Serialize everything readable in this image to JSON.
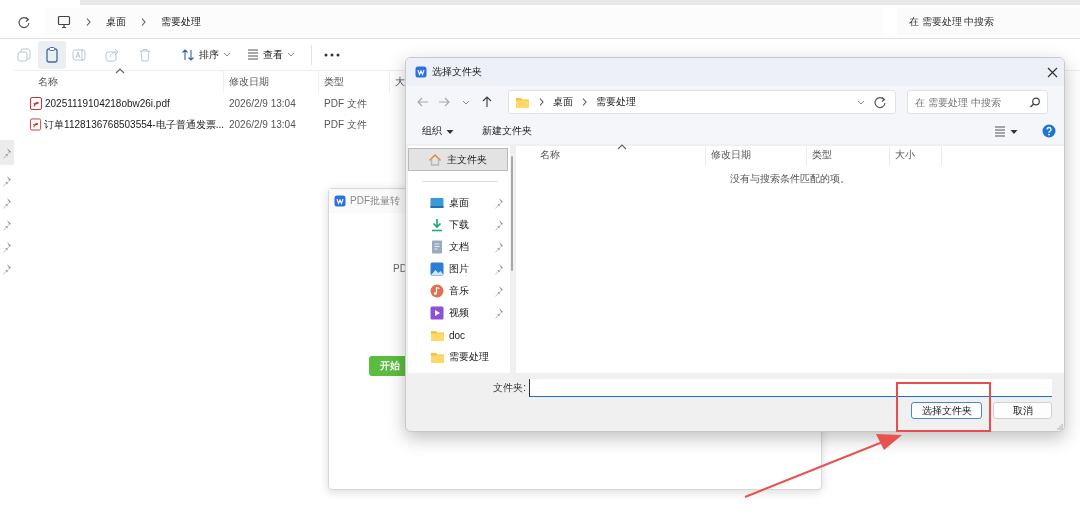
{
  "explorer": {
    "path": [
      "桌面",
      "需要处理"
    ],
    "search": {
      "placeholder": "在 需要处理 中搜索"
    },
    "sort_label": "排序",
    "view_label": "查看",
    "columns": [
      "名称",
      "修改日期",
      "类型",
      "大"
    ],
    "rows": [
      {
        "name": "20251119104218obw26i.pdf",
        "modified": "2026/2/9 13:04",
        "type": "PDF 文件"
      },
      {
        "name": "订单1128136768503554-电子普通发票...",
        "modified": "2026/2/9 13:04",
        "type": "PDF 文件"
      }
    ]
  },
  "app": {
    "title": "PDF批量转",
    "text": "PD",
    "button": "开始"
  },
  "dialog": {
    "title": "选择文件夹",
    "path": [
      "桌面",
      "需要处理"
    ],
    "search": {
      "placeholder": "在 需要处理 中搜索"
    },
    "organize": "组织",
    "new_folder": "新建文件夹",
    "nav_items": [
      {
        "label": "主文件夹",
        "kind": "home",
        "selected": true,
        "pinned": false
      },
      {
        "label": "桌面",
        "kind": "desktop",
        "selected": false,
        "pinned": true
      },
      {
        "label": "下载",
        "kind": "download",
        "selected": false,
        "pinned": true
      },
      {
        "label": "文档",
        "kind": "documents",
        "selected": false,
        "pinned": true
      },
      {
        "label": "图片",
        "kind": "pictures",
        "selected": false,
        "pinned": true
      },
      {
        "label": "音乐",
        "kind": "music",
        "selected": false,
        "pinned": true
      },
      {
        "label": "视频",
        "kind": "videos",
        "selected": false,
        "pinned": true
      },
      {
        "label": "doc",
        "kind": "folder",
        "selected": false,
        "pinned": false
      },
      {
        "label": "需要处理",
        "kind": "folder",
        "selected": false,
        "pinned": false
      }
    ],
    "columns": [
      "名称",
      "修改日期",
      "类型",
      "大小"
    ],
    "empty_message": "没有与搜索条件匹配的项。",
    "folder_label": "文件夹:",
    "buttons": [
      {
        "label": "选择文件夹",
        "default": true
      },
      {
        "label": "取消",
        "default": false
      }
    ]
  }
}
